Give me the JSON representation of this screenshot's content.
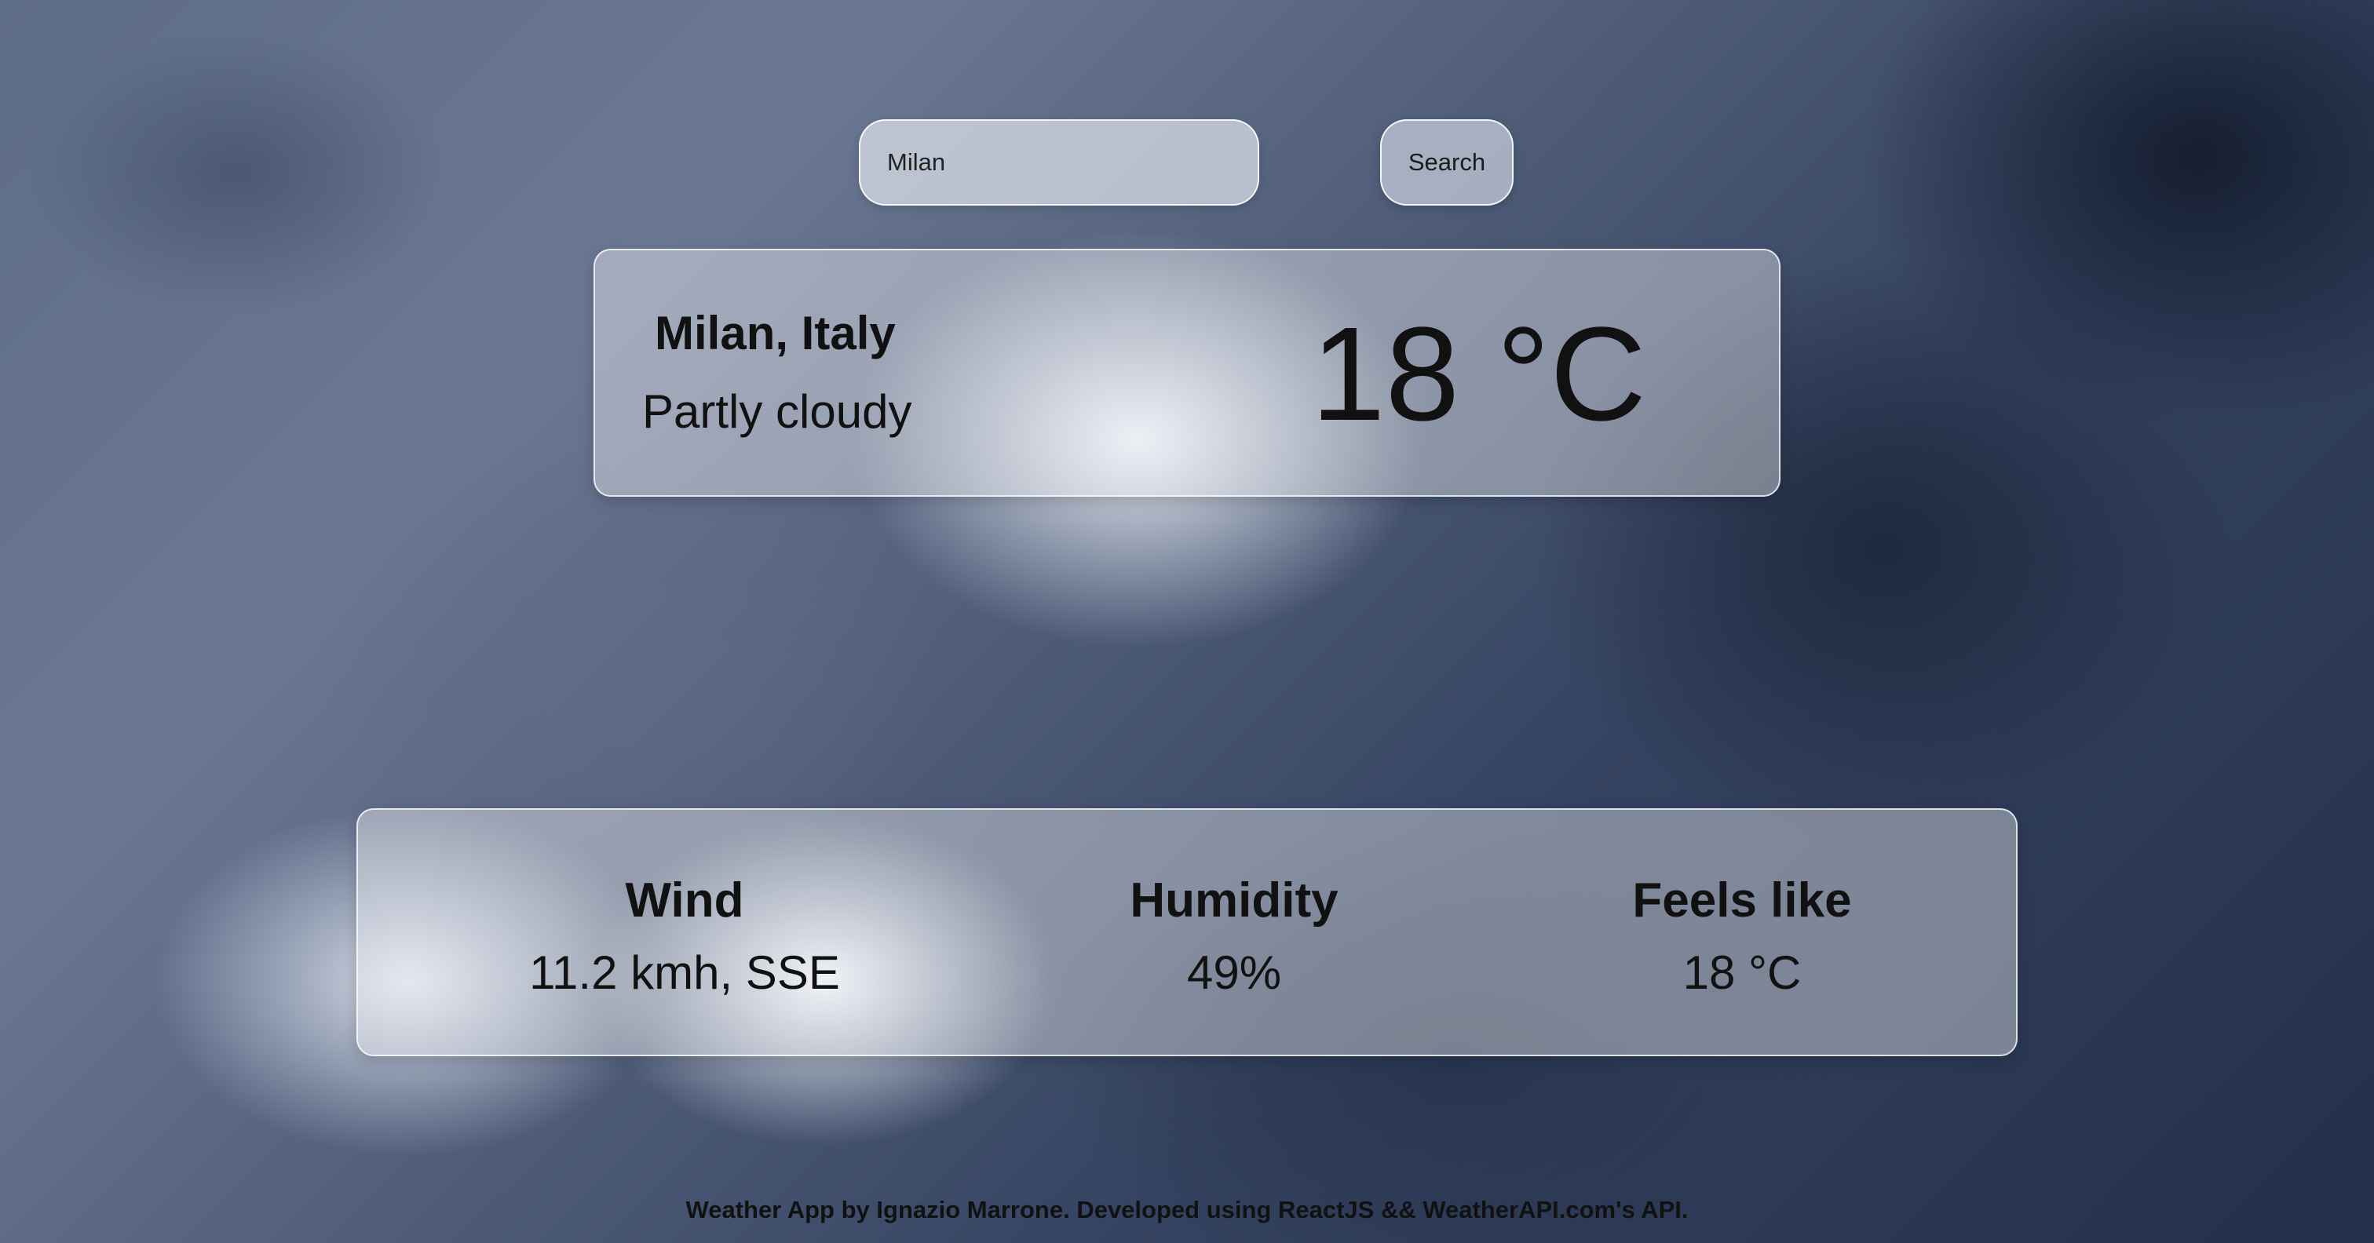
{
  "search": {
    "value": "Milan",
    "button_label": "Search"
  },
  "current": {
    "location": "Milan, Italy",
    "condition": "Partly cloudy",
    "temperature": "18 °C"
  },
  "stats": [
    {
      "label": "Wind",
      "value": "11.2 kmh, SSE"
    },
    {
      "label": "Humidity",
      "value": "49%"
    },
    {
      "label": "Feels like",
      "value": "18 °C"
    }
  ],
  "footer": {
    "text": "Weather App by Ignazio Marrone. Developed using ReactJS && WeatherAPI.com's API."
  }
}
